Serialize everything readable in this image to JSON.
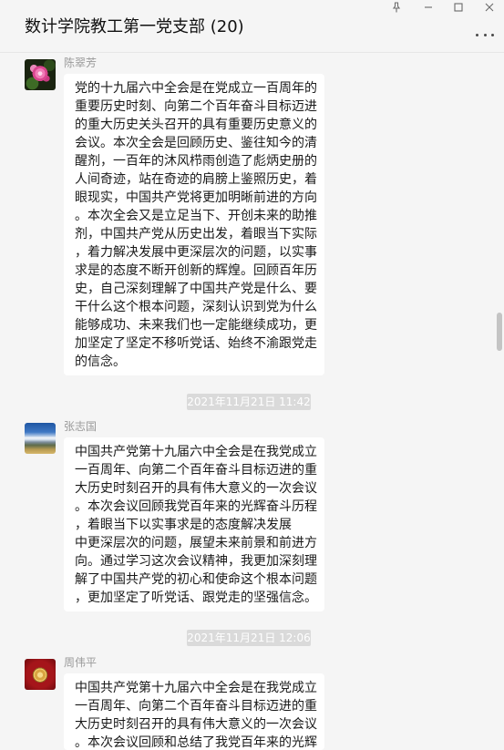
{
  "window": {
    "title": "数计学院教工第一党支部 (20)"
  },
  "icons": {
    "pin": "pin-icon",
    "minimize": "minimize-icon",
    "maximize": "maximize-icon",
    "close": "close-icon",
    "more": "more-icon"
  },
  "colors": {
    "background": "#f5f5f5",
    "bubble": "#ffffff",
    "timestamp_background": "#dadada",
    "timestamp_text": "#ffffff",
    "sender_name": "#9a9a9a",
    "message_text": "#191919"
  },
  "chat": {
    "items": [
      {
        "kind": "message",
        "sender": "陈翠芳",
        "avatar": "pink-flower-avatar",
        "lines": [
          "党的十九届六中全会是在党成立一百周年的",
          "重要历史时刻、向第二个百年奋斗目标迈进",
          "的重大历史关头召开的具有重要历史意义的",
          "会议。本次全会是回顾历史、鉴往知今的清",
          "醒剂，一百年的沐风栉雨创造了彪炳史册的",
          "人间奇迹，站在奇迹的肩膀上鉴照历史，着",
          "眼现实，中国共产党将更加明晰前进的方向",
          "。本次全会又是立足当下、开创未来的助推",
          "剂，中国共产党从历史出发，着眼当下实际",
          "，着力解决发展中更深层次的问题，以实事",
          "求是的态度不断开创新的辉煌。回顾百年历",
          "史，自己深刻理解了中国共产党是什么、要",
          "干什么这个根本问题，深刻认识到党为什么",
          "能够成功、未来我们也一定能继续成功，更",
          "加坚定了坚定不移听党话、始终不渝跟党走",
          "的信念。"
        ]
      },
      {
        "kind": "time",
        "text": "2021年11月21日 11:42"
      },
      {
        "kind": "message",
        "sender": "张志国",
        "avatar": "sky-landscape-avatar",
        "lines": [
          "中国共产党第十九届六中全会是在我党成立",
          "一百周年、向第二个百年奋斗目标迈进的重",
          "大历史时刻召开的具有伟大意义的一次会议",
          "。本次会议回顾我党百年来的光辉奋斗历程",
          "，着眼当下以实事求是的态度解决发展",
          "中更深层次的问题，展望未来前景和前进方",
          "向。通过学习这次会议精神，我更加深刻理",
          "解了中国共产党的初心和使命这个根本问题",
          "，更加坚定了听党话、跟党走的坚强信念。"
        ]
      },
      {
        "kind": "time",
        "text": "2021年11月21日 12:06"
      },
      {
        "kind": "message",
        "sender": "周伟平",
        "avatar": "red-emblem-avatar",
        "lines": [
          "中国共产党第十九届六中全会是在我党成立",
          "一百周年、向第二个百年奋斗目标迈进的重",
          "大历史时刻召开的具有伟大意义的一次会议",
          "。本次会议回顾和总结了我党百年来的光辉"
        ]
      }
    ]
  }
}
